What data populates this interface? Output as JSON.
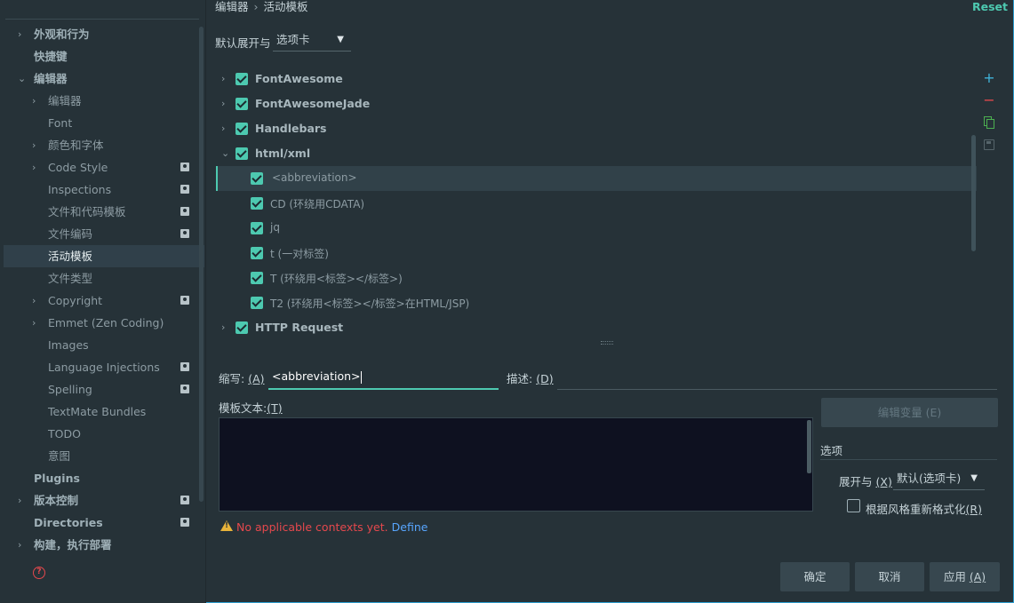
{
  "breadcrumb": {
    "parent": "编辑器",
    "separator": "›",
    "current": "活动模板"
  },
  "reset_label": "Reset",
  "expand": {
    "label": "默认展开与",
    "value": "选项卡"
  },
  "sidebar": {
    "items": [
      {
        "label": "外观和行为",
        "arrow": "›",
        "bold": true
      },
      {
        "label": "快捷键",
        "arrow": "",
        "bold": true
      },
      {
        "label": "编辑器",
        "arrow": "⌄",
        "bold": true
      },
      {
        "label": "编辑器",
        "arrow": "›",
        "bold": false
      },
      {
        "label": "Font",
        "arrow": "",
        "bold": false
      },
      {
        "label": "颜色和字体",
        "arrow": "›",
        "bold": false
      },
      {
        "label": "Code Style",
        "arrow": "›",
        "bold": false
      },
      {
        "label": "Inspections",
        "arrow": "",
        "bold": false
      },
      {
        "label": "文件和代码模板",
        "arrow": "",
        "bold": false
      },
      {
        "label": "文件编码",
        "arrow": "",
        "bold": false
      },
      {
        "label": "活动模板",
        "arrow": "",
        "bold": false
      },
      {
        "label": "文件类型",
        "arrow": "",
        "bold": false
      },
      {
        "label": "Copyright",
        "arrow": "›",
        "bold": false
      },
      {
        "label": "Emmet (Zen Coding)",
        "arrow": "›",
        "bold": false
      },
      {
        "label": "Images",
        "arrow": "",
        "bold": false
      },
      {
        "label": "Language Injections",
        "arrow": "",
        "bold": false
      },
      {
        "label": "Spelling",
        "arrow": "",
        "bold": false
      },
      {
        "label": "TextMate Bundles",
        "arrow": "",
        "bold": false
      },
      {
        "label": "TODO",
        "arrow": "",
        "bold": false
      },
      {
        "label": "意图",
        "arrow": "",
        "bold": false
      },
      {
        "label": "Plugins",
        "arrow": "",
        "bold": true
      },
      {
        "label": "版本控制",
        "arrow": "›",
        "bold": true
      },
      {
        "label": "Directories",
        "arrow": "",
        "bold": true
      },
      {
        "label": "构建，执行部署",
        "arrow": "›",
        "bold": true
      }
    ]
  },
  "tree": {
    "rows": [
      {
        "label": "FontAwesome",
        "arrow": "›"
      },
      {
        "label": "FontAwesomeJade",
        "arrow": "›"
      },
      {
        "label": "Handlebars",
        "arrow": "›"
      },
      {
        "label": "html/xml",
        "arrow": "⌄"
      },
      {
        "label": "<abbreviation>",
        "arrow": ""
      },
      {
        "label": "CD (环绕用CDATA)",
        "arrow": ""
      },
      {
        "label": "jq",
        "arrow": ""
      },
      {
        "label": "t (一对标签)",
        "arrow": ""
      },
      {
        "label": "T (环绕用<标签></标签>)",
        "arrow": ""
      },
      {
        "label": "T2 (环绕用<标签></标签>在HTML/JSP)",
        "arrow": ""
      },
      {
        "label": "HTTP Request",
        "arrow": "›"
      }
    ]
  },
  "tools": {
    "add": "+",
    "remove": "−"
  },
  "form": {
    "abbr_label": "缩写:",
    "abbr_key": "(A)",
    "abbr_value": "<abbreviation>",
    "desc_label": "描述:",
    "desc_key": "(D)",
    "text_label": "模板文本:",
    "text_key": "(T)",
    "text_value": "",
    "edit_vars": "编辑变量 (E)",
    "options_title": "选项",
    "expand_with_label": "展开与",
    "expand_with_key": "(X)",
    "expand_with_value": "默认(选项卡)",
    "reformat_label": "根据风格重新格式化",
    "reformat_key": "(R)"
  },
  "warning": {
    "text": "No applicable contexts yet.",
    "link": "Define"
  },
  "buttons": {
    "ok": "确定",
    "cancel": "取消",
    "apply": "应用",
    "apply_key": "(A)"
  },
  "help_icon": "?",
  "colors": {
    "accent": "#4dc9b0",
    "warning": "#e5484d",
    "link": "#58a6ff",
    "background": "#263238"
  }
}
